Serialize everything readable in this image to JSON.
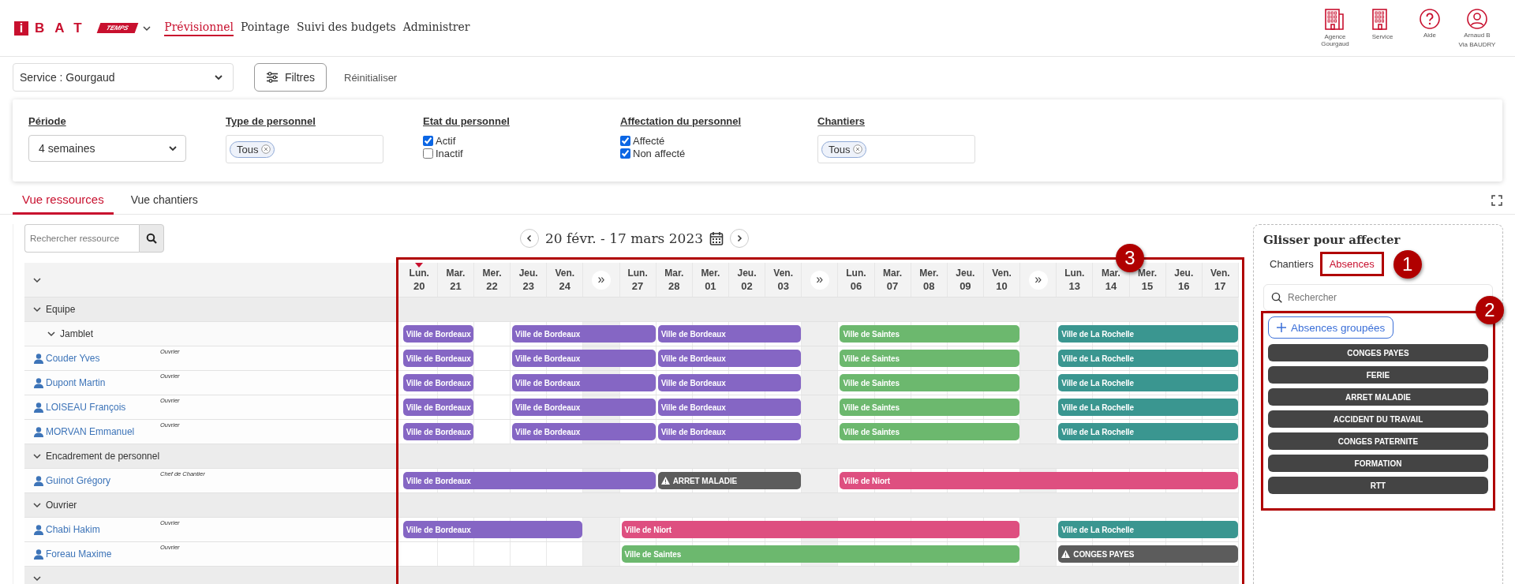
{
  "header": {
    "logo": {
      "mark": "i",
      "name": "BAT",
      "badge": "TEMPS"
    },
    "nav": [
      {
        "label": "Prévisionnel",
        "selected": true
      },
      {
        "label": "Pointage",
        "selected": false
      },
      {
        "label": "Suivi des budgets",
        "selected": false
      },
      {
        "label": "Administrer",
        "selected": false
      }
    ],
    "shortcuts": [
      {
        "kind": "agency",
        "label": "Agence Gourgaud"
      },
      {
        "kind": "building",
        "label": "Service"
      },
      {
        "kind": "help",
        "label": "Aide"
      },
      {
        "kind": "user",
        "label": "Arnaud B",
        "sublabel": "Via BAUDRY"
      }
    ]
  },
  "toolbar": {
    "service_select": "Service : Gourgaud",
    "filters_button": "Filtres",
    "reset_link": "Réinitialiser"
  },
  "filters": [
    {
      "kind": "select",
      "label": "Période",
      "value": "4 semaines"
    },
    {
      "kind": "tags",
      "label": "Type de personnel",
      "tags": [
        "Tous"
      ]
    },
    {
      "kind": "checks",
      "label": "Etat du personnel",
      "options": [
        {
          "label": "Actif",
          "checked": true
        },
        {
          "label": "Inactif",
          "checked": false
        }
      ]
    },
    {
      "kind": "checks",
      "label": "Affectation du personnel",
      "options": [
        {
          "label": "Affecté",
          "checked": true
        },
        {
          "label": "Non affecté",
          "checked": true
        }
      ]
    },
    {
      "kind": "tags",
      "label": "Chantiers",
      "tags": [
        "Tous"
      ]
    }
  ],
  "views": [
    {
      "label": "Vue ressources",
      "selected": true
    },
    {
      "label": "Vue chantiers",
      "selected": false
    }
  ],
  "planning": {
    "search_placeholder": "Rechercher ressource",
    "period": "20 févr. - 17 mars 2023"
  },
  "grid": {
    "callout": "3",
    "days": [
      {
        "kind": "day",
        "weekday": "Lun.",
        "date": "20",
        "today": true
      },
      {
        "kind": "day",
        "weekday": "Mar.",
        "date": "21",
        "today": false
      },
      {
        "kind": "day",
        "weekday": "Mer.",
        "date": "22",
        "today": false
      },
      {
        "kind": "day",
        "weekday": "Jeu.",
        "date": "23",
        "today": false
      },
      {
        "kind": "day",
        "weekday": "Ven.",
        "date": "24",
        "today": false
      },
      {
        "kind": "skip",
        "label": "»"
      },
      {
        "kind": "day",
        "weekday": "Lun.",
        "date": "27",
        "today": false
      },
      {
        "kind": "day",
        "weekday": "Mar.",
        "date": "28",
        "today": false
      },
      {
        "kind": "day",
        "weekday": "Mer.",
        "date": "01",
        "today": false
      },
      {
        "kind": "day",
        "weekday": "Jeu.",
        "date": "02",
        "today": false
      },
      {
        "kind": "day",
        "weekday": "Ven.",
        "date": "03",
        "today": false
      },
      {
        "kind": "skip",
        "label": "»"
      },
      {
        "kind": "day",
        "weekday": "Lun.",
        "date": "06",
        "today": false
      },
      {
        "kind": "day",
        "weekday": "Mar.",
        "date": "07",
        "today": false
      },
      {
        "kind": "day",
        "weekday": "Mer.",
        "date": "08",
        "today": false
      },
      {
        "kind": "day",
        "weekday": "Jeu.",
        "date": "09",
        "today": false
      },
      {
        "kind": "day",
        "weekday": "Ven.",
        "date": "10",
        "today": false
      },
      {
        "kind": "skip",
        "label": "»"
      },
      {
        "kind": "day",
        "weekday": "Lun.",
        "date": "13",
        "today": false
      },
      {
        "kind": "day",
        "weekday": "Mar.",
        "date": "14",
        "today": false
      },
      {
        "kind": "day",
        "weekday": "Mer.",
        "date": "15",
        "today": false
      },
      {
        "kind": "day",
        "weekday": "Jeu.",
        "date": "16",
        "today": false
      },
      {
        "kind": "day",
        "weekday": "Ven.",
        "date": "17",
        "today": false
      }
    ],
    "rows": [
      {
        "kind": "group",
        "label": "Equipe",
        "expanded": true,
        "children": [
          {
            "kind": "subgroup",
            "label": "Jamblet",
            "expanded": true,
            "timeline": [
              {
                "kind": "site",
                "label": "Ville de Bordeaux",
                "color": "#8566c4"
              },
              {
                "kind": "cont"
              },
              {
                "kind": "free"
              },
              {
                "kind": "site",
                "label": "Ville de Bordeaux",
                "color": "#8566c4"
              },
              {
                "kind": "cont"
              },
              {
                "kind": "cont"
              },
              {
                "kind": "cont"
              },
              {
                "kind": "site",
                "label": "Ville de Bordeaux",
                "color": "#8566c4"
              },
              {
                "kind": "cont"
              },
              {
                "kind": "cont"
              },
              {
                "kind": "cont"
              },
              {
                "kind": "free"
              },
              {
                "kind": "site",
                "label": "Ville de Saintes",
                "color": "#6cb86e"
              },
              {
                "kind": "cont"
              },
              {
                "kind": "cont"
              },
              {
                "kind": "cont"
              },
              {
                "kind": "cont"
              },
              {
                "kind": "free"
              },
              {
                "kind": "site",
                "label": "Ville de La Rochelle",
                "color": "#3a9690"
              },
              {
                "kind": "cont"
              },
              {
                "kind": "cont"
              },
              {
                "kind": "cont"
              },
              {
                "kind": "cont"
              }
            ],
            "children": [
              {
                "kind": "person",
                "name": "Couder Yves",
                "role": "Ouvrier",
                "timeline": [
                  {
                    "kind": "site",
                    "label": "Ville de Bordeaux",
                    "color": "#8566c4"
                  },
                  {
                    "kind": "cont"
                  },
                  {
                    "kind": "free"
                  },
                  {
                    "kind": "site",
                    "label": "Ville de Bordeaux",
                    "color": "#8566c4"
                  },
                  {
                    "kind": "cont"
                  },
                  {
                    "kind": "cont"
                  },
                  {
                    "kind": "cont"
                  },
                  {
                    "kind": "site",
                    "label": "Ville de Bordeaux",
                    "color": "#8566c4"
                  },
                  {
                    "kind": "cont"
                  },
                  {
                    "kind": "cont"
                  },
                  {
                    "kind": "cont"
                  },
                  {
                    "kind": "free"
                  },
                  {
                    "kind": "site",
                    "label": "Ville de Saintes",
                    "color": "#6cb86e"
                  },
                  {
                    "kind": "cont"
                  },
                  {
                    "kind": "cont"
                  },
                  {
                    "kind": "cont"
                  },
                  {
                    "kind": "cont"
                  },
                  {
                    "kind": "free"
                  },
                  {
                    "kind": "site",
                    "label": "Ville de La Rochelle",
                    "color": "#3a9690"
                  },
                  {
                    "kind": "cont"
                  },
                  {
                    "kind": "cont"
                  },
                  {
                    "kind": "cont"
                  },
                  {
                    "kind": "cont"
                  }
                ]
              },
              {
                "kind": "person",
                "name": "Dupont Martin",
                "role": "Ouvrier",
                "timeline": [
                  {
                    "kind": "site",
                    "label": "Ville de Bordeaux",
                    "color": "#8566c4"
                  },
                  {
                    "kind": "cont"
                  },
                  {
                    "kind": "free"
                  },
                  {
                    "kind": "site",
                    "label": "Ville de Bordeaux",
                    "color": "#8566c4"
                  },
                  {
                    "kind": "cont"
                  },
                  {
                    "kind": "cont"
                  },
                  {
                    "kind": "cont"
                  },
                  {
                    "kind": "site",
                    "label": "Ville de Bordeaux",
                    "color": "#8566c4"
                  },
                  {
                    "kind": "cont"
                  },
                  {
                    "kind": "cont"
                  },
                  {
                    "kind": "cont"
                  },
                  {
                    "kind": "free"
                  },
                  {
                    "kind": "site",
                    "label": "Ville de Saintes",
                    "color": "#6cb86e"
                  },
                  {
                    "kind": "cont"
                  },
                  {
                    "kind": "cont"
                  },
                  {
                    "kind": "cont"
                  },
                  {
                    "kind": "cont"
                  },
                  {
                    "kind": "free"
                  },
                  {
                    "kind": "site",
                    "label": "Ville de La Rochelle",
                    "color": "#3a9690"
                  },
                  {
                    "kind": "cont"
                  },
                  {
                    "kind": "cont"
                  },
                  {
                    "kind": "cont"
                  },
                  {
                    "kind": "cont"
                  }
                ]
              },
              {
                "kind": "person",
                "name": "LOISEAU François",
                "role": "Ouvrier",
                "timeline": [
                  {
                    "kind": "site",
                    "label": "Ville de Bordeaux",
                    "color": "#8566c4"
                  },
                  {
                    "kind": "cont"
                  },
                  {
                    "kind": "free"
                  },
                  {
                    "kind": "site",
                    "label": "Ville de Bordeaux",
                    "color": "#8566c4"
                  },
                  {
                    "kind": "cont"
                  },
                  {
                    "kind": "cont"
                  },
                  {
                    "kind": "cont"
                  },
                  {
                    "kind": "site",
                    "label": "Ville de Bordeaux",
                    "color": "#8566c4"
                  },
                  {
                    "kind": "cont"
                  },
                  {
                    "kind": "cont"
                  },
                  {
                    "kind": "cont"
                  },
                  {
                    "kind": "free"
                  },
                  {
                    "kind": "site",
                    "label": "Ville de Saintes",
                    "color": "#6cb86e"
                  },
                  {
                    "kind": "cont"
                  },
                  {
                    "kind": "cont"
                  },
                  {
                    "kind": "cont"
                  },
                  {
                    "kind": "cont"
                  },
                  {
                    "kind": "free"
                  },
                  {
                    "kind": "site",
                    "label": "Ville de La Rochelle",
                    "color": "#3a9690"
                  },
                  {
                    "kind": "cont"
                  },
                  {
                    "kind": "cont"
                  },
                  {
                    "kind": "cont"
                  },
                  {
                    "kind": "cont"
                  }
                ]
              },
              {
                "kind": "person",
                "name": "MORVAN Emmanuel",
                "role": "Ouvrier",
                "timeline": [
                  {
                    "kind": "site",
                    "label": "Ville de Bordeaux",
                    "color": "#8566c4"
                  },
                  {
                    "kind": "cont"
                  },
                  {
                    "kind": "free"
                  },
                  {
                    "kind": "site",
                    "label": "Ville de Bordeaux",
                    "color": "#8566c4"
                  },
                  {
                    "kind": "cont"
                  },
                  {
                    "kind": "cont"
                  },
                  {
                    "kind": "cont"
                  },
                  {
                    "kind": "site",
                    "label": "Ville de Bordeaux",
                    "color": "#8566c4"
                  },
                  {
                    "kind": "cont"
                  },
                  {
                    "kind": "cont"
                  },
                  {
                    "kind": "cont"
                  },
                  {
                    "kind": "free"
                  },
                  {
                    "kind": "site",
                    "label": "Ville de Saintes",
                    "color": "#6cb86e"
                  },
                  {
                    "kind": "cont"
                  },
                  {
                    "kind": "cont"
                  },
                  {
                    "kind": "cont"
                  },
                  {
                    "kind": "cont"
                  },
                  {
                    "kind": "free"
                  },
                  {
                    "kind": "site",
                    "label": "Ville de La Rochelle",
                    "color": "#3a9690"
                  },
                  {
                    "kind": "cont"
                  },
                  {
                    "kind": "cont"
                  },
                  {
                    "kind": "cont"
                  },
                  {
                    "kind": "cont"
                  }
                ]
              }
            ]
          }
        ]
      },
      {
        "kind": "group",
        "label": "Encadrement de personnel",
        "expanded": true,
        "children": [
          {
            "kind": "person",
            "name": "Guinot Grégory",
            "role": "Chef de Chantier",
            "timeline": [
              {
                "kind": "site",
                "label": "Ville de Bordeaux",
                "color": "#8566c4"
              },
              {
                "kind": "cont"
              },
              {
                "kind": "cont"
              },
              {
                "kind": "cont"
              },
              {
                "kind": "cont"
              },
              {
                "kind": "cont"
              },
              {
                "kind": "cont"
              },
              {
                "kind": "absence",
                "label": "ARRET MALADIE",
                "color": "#5c5c5c"
              },
              {
                "kind": "cont"
              },
              {
                "kind": "cont"
              },
              {
                "kind": "cont"
              },
              {
                "kind": "free"
              },
              {
                "kind": "site",
                "label": "Ville de Niort",
                "color": "#de4f80"
              },
              {
                "kind": "cont"
              },
              {
                "kind": "cont"
              },
              {
                "kind": "cont"
              },
              {
                "kind": "cont"
              },
              {
                "kind": "cont"
              },
              {
                "kind": "cont"
              },
              {
                "kind": "cont"
              },
              {
                "kind": "cont"
              },
              {
                "kind": "cont"
              },
              {
                "kind": "cont"
              }
            ]
          }
        ]
      },
      {
        "kind": "group",
        "label": "Ouvrier",
        "expanded": true,
        "children": [
          {
            "kind": "person",
            "name": "Chabi Hakim",
            "role": "Ouvrier",
            "timeline": [
              {
                "kind": "site",
                "label": "Ville de Bordeaux",
                "color": "#8566c4"
              },
              {
                "kind": "cont"
              },
              {
                "kind": "cont"
              },
              {
                "kind": "cont"
              },
              {
                "kind": "cont"
              },
              {
                "kind": "free"
              },
              {
                "kind": "site",
                "label": "Ville de Niort",
                "color": "#de4f80"
              },
              {
                "kind": "cont"
              },
              {
                "kind": "cont"
              },
              {
                "kind": "cont"
              },
              {
                "kind": "cont"
              },
              {
                "kind": "cont"
              },
              {
                "kind": "cont"
              },
              {
                "kind": "cont"
              },
              {
                "kind": "cont"
              },
              {
                "kind": "cont"
              },
              {
                "kind": "cont"
              },
              {
                "kind": "free"
              },
              {
                "kind": "site",
                "label": "Ville de La Rochelle",
                "color": "#3a9690"
              },
              {
                "kind": "cont"
              },
              {
                "kind": "cont"
              },
              {
                "kind": "cont"
              },
              {
                "kind": "cont"
              }
            ]
          },
          {
            "kind": "person",
            "name": "Foreau Maxime",
            "role": "Ouvrier",
            "timeline": [
              {
                "kind": "free"
              },
              {
                "kind": "free"
              },
              {
                "kind": "free"
              },
              {
                "kind": "free"
              },
              {
                "kind": "free"
              },
              {
                "kind": "free"
              },
              {
                "kind": "site",
                "label": "Ville de Saintes",
                "color": "#6cb86e"
              },
              {
                "kind": "cont"
              },
              {
                "kind": "cont"
              },
              {
                "kind": "cont"
              },
              {
                "kind": "cont"
              },
              {
                "kind": "cont"
              },
              {
                "kind": "cont"
              },
              {
                "kind": "cont"
              },
              {
                "kind": "cont"
              },
              {
                "kind": "cont"
              },
              {
                "kind": "cont"
              },
              {
                "kind": "free"
              },
              {
                "kind": "absence",
                "label": "CONGES PAYES",
                "color": "#5c5c5c"
              },
              {
                "kind": "cont"
              },
              {
                "kind": "cont"
              },
              {
                "kind": "cont"
              },
              {
                "kind": "cont"
              }
            ]
          }
        ]
      },
      {
        "kind": "group",
        "expanded": true,
        "children": []
      }
    ]
  },
  "assign_panel": {
    "title": "Glisser pour affecter",
    "tabs": [
      {
        "label": "Chantiers",
        "selected": false
      },
      {
        "label": "Absences",
        "selected": true,
        "callout": "1"
      }
    ],
    "search_placeholder": "Rechercher",
    "absences": {
      "callout": "2",
      "group_button": "Absences groupées",
      "items": [
        "CONGES PAYES",
        "FERIE",
        "ARRET MALADIE",
        "ACCIDENT DU TRAVAIL",
        "CONGES PATERNITE",
        "FORMATION",
        "RTT"
      ]
    }
  }
}
